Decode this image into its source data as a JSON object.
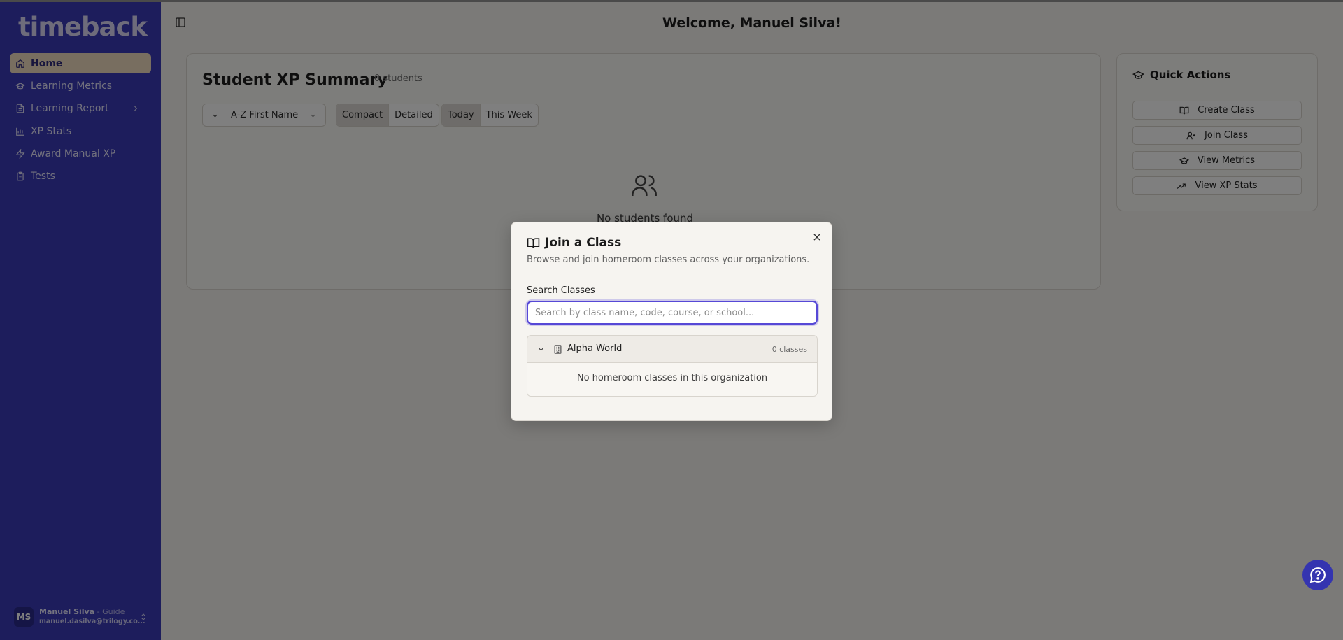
{
  "app": {
    "logo": "timeback"
  },
  "sidebar": {
    "items": [
      {
        "label": "Home",
        "icon": "home-icon",
        "active": true
      },
      {
        "label": "Learning Metrics",
        "icon": "graduation-cap-icon"
      },
      {
        "label": "Learning Report",
        "icon": "file-icon",
        "has_submenu": true
      },
      {
        "label": "XP Stats",
        "icon": "bar-chart-icon"
      },
      {
        "label": "Award Manual XP",
        "icon": "zap-icon"
      },
      {
        "label": "Tests",
        "icon": "clipboard-icon"
      }
    ],
    "user": {
      "initials": "MS",
      "name": "Manuel Silva",
      "role": " - Guide",
      "email": "manuel.dasilva@trilogy.co..."
    }
  },
  "header": {
    "welcome": "Welcome, Manuel Silva!"
  },
  "summary": {
    "title": "Student XP Summary",
    "count": "0 students",
    "sort_value": "A-Z First Name",
    "view_toggle": [
      "Compact",
      "Detailed"
    ],
    "view_selected": "Compact",
    "range_toggle": [
      "Today",
      "This Week"
    ],
    "range_selected": "Today",
    "empty_text": "No students found"
  },
  "quick_actions": {
    "title": "Quick Actions",
    "buttons": [
      {
        "label": "Create Class",
        "icon": "book-open-icon"
      },
      {
        "label": "Join Class",
        "icon": "user-plus-icon"
      },
      {
        "label": "View Metrics",
        "icon": "graduation-cap-icon"
      },
      {
        "label": "View XP Stats",
        "icon": "trending-up-icon"
      }
    ]
  },
  "modal": {
    "title": "Join a Class",
    "description": "Browse and join homeroom classes across your organizations.",
    "search_label": "Search Classes",
    "search_placeholder": "Search by class name, code, course, or school...",
    "search_value": "",
    "org": {
      "name": "Alpha World",
      "count": "0 classes",
      "empty": "No homeroom classes in this organization"
    }
  },
  "colors": {
    "sidebar_bg": "#3a3ab8",
    "active_item_bg": "#f1dcc1",
    "accent": "#5648d6",
    "help_button": "#3434b0"
  }
}
